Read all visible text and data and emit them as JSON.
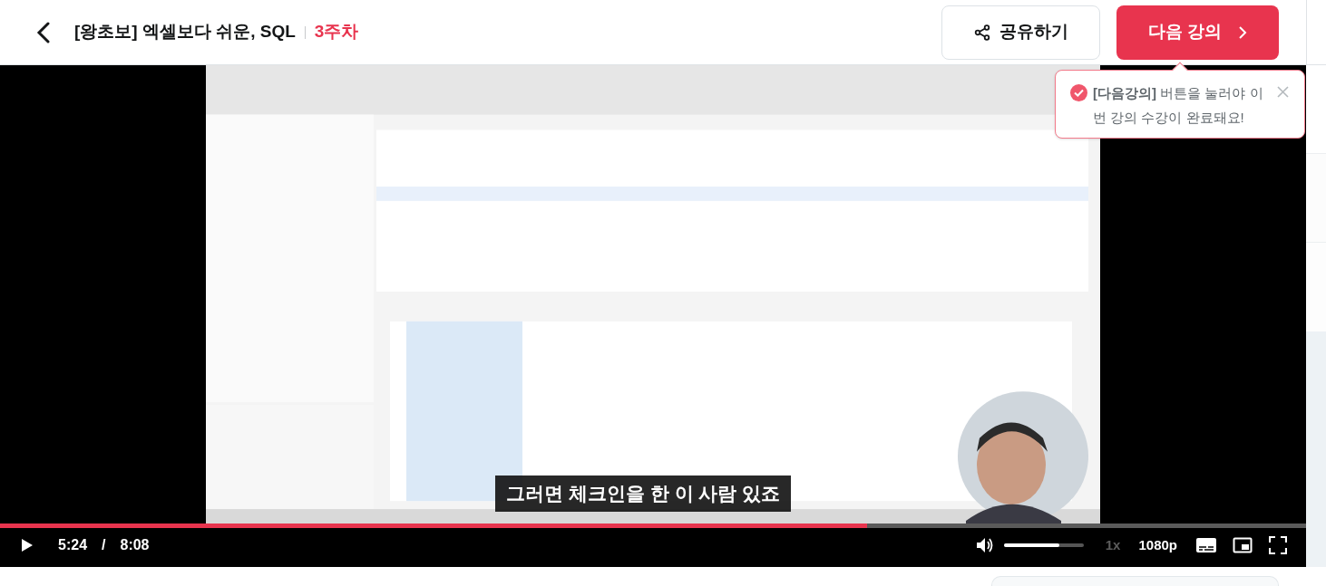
{
  "header": {
    "title": "[왕초보] 엑셀보다 쉬운, SQL",
    "week": "3주차",
    "share_button": "공유하기",
    "next_button": "다음 강의"
  },
  "tooltip": {
    "message": "**[다음강의]** 버튼을 눌러야 이번 강의 수강이 완료돼요!"
  },
  "player": {
    "caption": "그러면 체크인을 한 이 사람 있죠",
    "progress": {
      "level": 0.664
    },
    "current_time": "5:24",
    "separator": "/",
    "duration": "8:08",
    "volume": {
      "level": 0.7
    },
    "speed": "1x",
    "quality": "1080p"
  }
}
